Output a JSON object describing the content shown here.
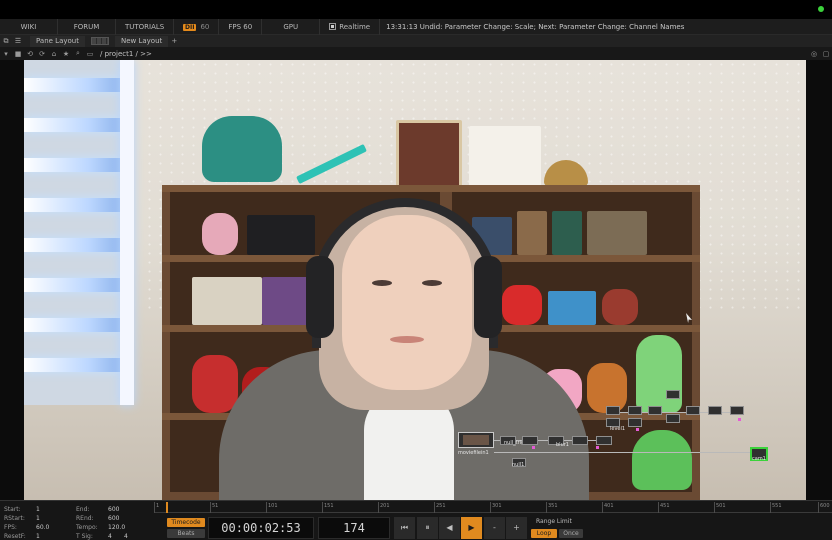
{
  "menubar": {
    "items": [
      "WIKI",
      "FORUM",
      "TUTORIALS"
    ],
    "badge": "DII",
    "badge_num": "60",
    "fps_label": "FPS 60",
    "gpu_label": "GPU",
    "realtime_label": "Realtime",
    "status_text": "13:31:13 Undid: Parameter Change: Scale; Next: Parameter Change: Channel Names"
  },
  "panebar": {
    "pane_layout": "Pane Layout",
    "new_layout": "New Layout",
    "add": "+"
  },
  "pathbar": {
    "path": "/ project1 / >>"
  },
  "network": {
    "node_labels": [
      "moviefilein1",
      "null_trigger",
      "blur1",
      "level1",
      "null1",
      "cam1"
    ]
  },
  "timeline": {
    "stats": {
      "start_label": "Start:",
      "start_value": "1",
      "rstart_label": "RStart:",
      "rstart_value": "1",
      "fps_label": "FPS:",
      "fps_value": "60.0",
      "resetf_label": "ResetF:",
      "resetf_value": "1",
      "end_label": "End:",
      "end_value": "600",
      "rend_label": "REnd:",
      "rend_value": "600",
      "tempo_label": "Tempo:",
      "tempo_value": "120.0",
      "tsig_label": "T Sig:",
      "tsig_value_a": "4",
      "tsig_value_b": "4"
    },
    "ruler_ticks": [
      "1",
      "51",
      "101",
      "151",
      "201",
      "251",
      "301",
      "351",
      "401",
      "451",
      "501",
      "551",
      "600"
    ],
    "timecode_label": "Timecode",
    "beats_label": "Beats",
    "timecode": "00:00:02:53",
    "frame": "174",
    "transport": {
      "rewind": "⏮",
      "pause": "⏸",
      "step_back": "◀",
      "play": "▶",
      "minus": "-",
      "plus": "+"
    },
    "range_limit": "Range Limit",
    "loop": "Loop",
    "once": "Once"
  },
  "colors": {
    "accent": "#e08a1f",
    "panel": "#1d1d1d",
    "node_pink": "#e55bd6",
    "node_selected": "#3bd23b"
  }
}
